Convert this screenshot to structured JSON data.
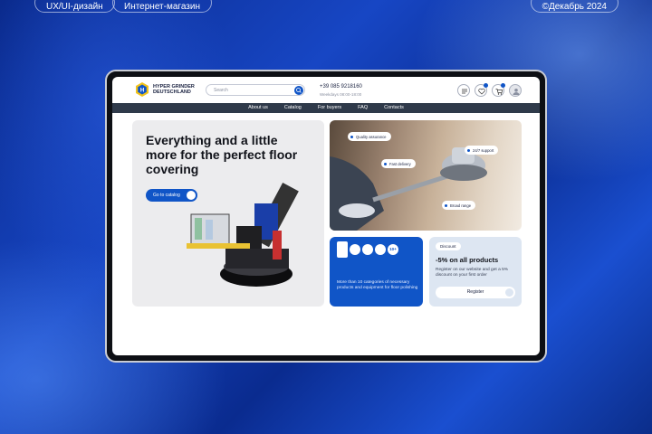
{
  "top_tags": {
    "left1": "UX/UI-дизайн",
    "left2": "Интернет-магазин",
    "right": "©Декабрь 2024"
  },
  "header": {
    "logo_line1": "HYPER GRINDER",
    "logo_line2": "DEUTSCHLAND",
    "search_placeholder": "Search",
    "phone": "+39 085 9218160",
    "hours": "Weekdays 08:00-18:00"
  },
  "nav": [
    "About us",
    "Catalog",
    "For buyers",
    "FAQ",
    "Contacts"
  ],
  "hero": {
    "title": "Everything and a little more for the perfect floor covering",
    "cta": "Go to catalog"
  },
  "photo_tags": [
    "Quality assurance",
    "Fast delivery",
    "24/7 support",
    "Broad range"
  ],
  "blue_card": {
    "badge": "10+",
    "text": "More than 10 categories of necessary products and equipment for floor polishing"
  },
  "discount_card": {
    "badge": "Discount",
    "title": "-5% on all products",
    "text": "Register on our website and get a 5% discount on your first order",
    "button": "Register"
  },
  "colors": {
    "accent": "#1055c7",
    "nav_bg": "#2f3a4a",
    "bg": "#0b2d8a"
  }
}
